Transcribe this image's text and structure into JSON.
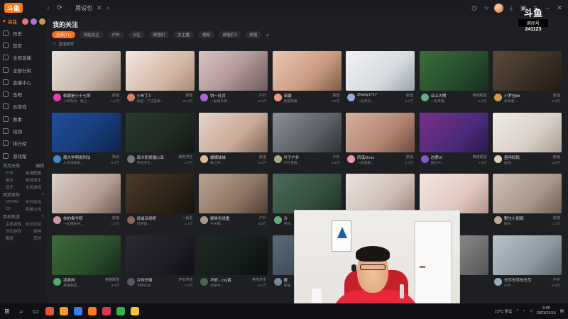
{
  "topbar": {
    "logo": "斗鱼",
    "tab_label": "用设也",
    "close_glyph": "✕",
    "search_glyph": "⌕"
  },
  "watermark": {
    "line1": "斗鱼",
    "line2": "房间号",
    "line3": "241123"
  },
  "sidebar": {
    "top": {
      "follow": "关注",
      "badge": "3"
    },
    "items": [
      "历史",
      "首页",
      "全部直播",
      "全部分类",
      "直播中心",
      "鱼吧",
      "云游戏",
      "赛事",
      "视频",
      "排行榜",
      "游戏聚"
    ],
    "sections": [
      {
        "title": "常用分类",
        "action": "编辑",
        "subs": [
          [
            "户外",
            "英雄联盟"
          ],
          [
            "美女",
            "绝地求生"
          ],
          [
            "音乐",
            "主机游戏"
          ]
        ]
      },
      {
        "title": "网游竞技",
        "action": "+",
        "subs": [
          [
            "DOTA2",
            "炉石传说"
          ],
          [
            "CF",
            "穿越火线"
          ]
        ]
      },
      {
        "title": "单机热游",
        "action": "+",
        "subs": [
          [
            "主机游戏",
            "永劫无间"
          ],
          [
            "怀旧游戏",
            "原神"
          ],
          [
            "魔兽",
            "其他"
          ]
        ]
      }
    ]
  },
  "main": {
    "title": "我的关注",
    "chips": [
      "全部(77)",
      "特别关注",
      "户外",
      "分区",
      "颜值们",
      "女主播",
      "视频",
      "颜值们2",
      "颜值"
    ],
    "chip_add": "+",
    "live_now": "直播推荐"
  },
  "cards": [
    {
      "name": "韩娜是小十七即",
      "sub": "十四有你，舞上...",
      "cat": "颜值",
      "views": "1.1万"
    },
    {
      "name": "小布丁3",
      "sub": "就是一下这些事...",
      "cat": "颜值",
      "views": "22.9万"
    },
    {
      "name": "饼～旺井",
      "sub": "一起看风景...",
      "cat": "户外",
      "views": "8.1万"
    },
    {
      "name": "菲婕",
      "sub": "我是菲婕",
      "cat": "颜值",
      "views": "2.5万"
    },
    {
      "name": "Zhang1717",
      "sub": "一起来玩...",
      "cat": "颜值",
      "views": "3.7万"
    },
    {
      "name": "深山大鳄",
      "sub": "一起来看...",
      "cat": "英雄联盟",
      "views": "5.2万"
    },
    {
      "name": "小罗包bb",
      "sub": "快来看...",
      "cat": "颜值",
      "views": "1.8万"
    },
    {
      "name": "周大学明说刑法",
      "sub": "从法律角度...",
      "cat": "知识",
      "views": "9.3万"
    },
    {
      "name": "高冷轮饱播心亚",
      "sub": "绝地求生...",
      "cat": "绝地求生",
      "views": "4.0万"
    },
    {
      "name": "蝴蝶妹妹",
      "sub": "晚上好...",
      "cat": "颜值",
      "views": "2.9万"
    },
    {
      "name": "叶子户外",
      "sub": "户外直播...",
      "cat": "户外",
      "views": "6.6万"
    },
    {
      "name": "雨溪Oooo",
      "sub": "一起唱歌...",
      "cat": "颜值",
      "views": "1.4万"
    },
    {
      "name": "达摩UI",
      "sub": "排位中...",
      "cat": "英雄联盟",
      "views": "7.5万"
    },
    {
      "name": "墨冉妈妈",
      "sub": "颜值...",
      "cat": "颜值",
      "views": "3.1万"
    },
    {
      "name": "你的奥兮呀",
      "sub": "一起来聊天...",
      "cat": "颜值",
      "views": "1.7万"
    },
    {
      "name": "逍遥杂戏呢",
      "sub": "历史剧...",
      "cat": "一起看",
      "views": "2.3万"
    },
    {
      "name": "娱昊坐说重",
      "sub": "今天聊...",
      "cat": "户外",
      "views": "5.8万"
    },
    {
      "name": "冷",
      "sub": "绝地...",
      "cat": "绝地求生",
      "views": "4.4万"
    },
    {
      "name": "",
      "sub": "",
      "cat": "",
      "views": ""
    },
    {
      "name": "",
      "sub": "",
      "cat": "",
      "views": ""
    },
    {
      "name": "野生小丽睛",
      "sub": "聊天...",
      "cat": "颜值",
      "views": "1.2万"
    },
    {
      "name": "凌尧闲",
      "sub": "英雄联盟...",
      "cat": "英雄联盟",
      "views": "3.3万"
    },
    {
      "name": "冷你仔嗑",
      "sub": "卡牌对战...",
      "cat": "炉石传说",
      "views": "2.0万"
    },
    {
      "name": "华府 - csy黄",
      "sub": "对局中...",
      "cat": "绝地求生",
      "views": "6.1万"
    },
    {
      "name": "搬",
      "sub": "颜值...",
      "cat": "颜值",
      "views": "1.0万"
    },
    {
      "name": "",
      "sub": "",
      "cat": "",
      "views": ""
    },
    {
      "name": "",
      "sub": "",
      "cat": "",
      "views": ""
    },
    {
      "name": "无尽无尽的无尽",
      "sub": "户外...",
      "cat": "户外",
      "views": "2.6万"
    }
  ],
  "taskbar": {
    "weather": "13°C 多云",
    "time": "3:05",
    "date": "2021/11/15"
  }
}
